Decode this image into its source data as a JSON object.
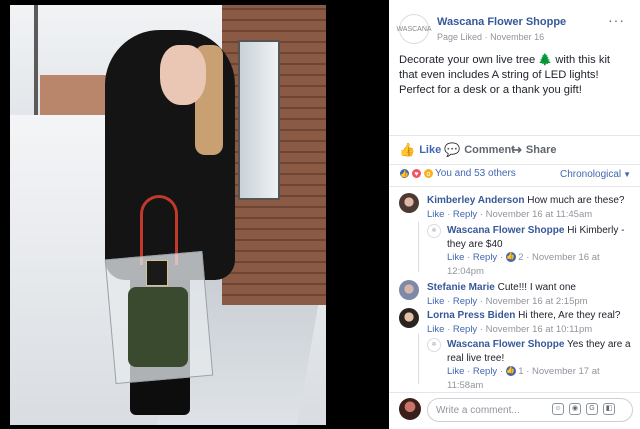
{
  "page": {
    "name": "Wascana Flower Shoppe",
    "status": "Page Liked",
    "date": "November 16",
    "avatar_text": "WASCANA"
  },
  "post": {
    "text": "Decorate your own live tree 🌲 with this kit that even includes A string of LED lights! Perfect for a desk or a thank you gift!"
  },
  "actions": {
    "like": "Like",
    "comment": "Comment",
    "share": "Share"
  },
  "reactions": {
    "summary": "You and 53 others"
  },
  "sort": {
    "label": "Chronological"
  },
  "comments": [
    {
      "author": "Kimberley Anderson",
      "text": "How much are these?",
      "like": "Like",
      "reply": "Reply",
      "time": "November 16 at 11:45am"
    },
    {
      "author": "Wascana Flower Shoppe",
      "text_line1": "Hi Kimberly -",
      "text_line2": "they are $40",
      "like": "Like",
      "reply": "Reply",
      "reactions": "2",
      "time_line1": "November 16 at",
      "time_line2": "12:04pm"
    },
    {
      "author": "Stefanie Marie",
      "text": "Cute!!! I want one",
      "like": "Like",
      "reply": "Reply",
      "time": "November 16 at 2:15pm"
    },
    {
      "author": "Lorna Press Biden",
      "text": "Hi there, Are they real?",
      "like": "Like",
      "reply": "Reply",
      "time": "November 16 at 10:11pm"
    },
    {
      "author": "Wascana Flower Shoppe",
      "text_line1": "Yes they are a",
      "text_line2": "real live tree!",
      "like": "Like",
      "reply": "Reply",
      "reactions": "1",
      "time": "November 17 at",
      "time_line2": "11:58am"
    }
  ],
  "composer": {
    "placeholder": "Write a comment..."
  },
  "colors": {
    "link": "#365899",
    "accent": "#4267b2",
    "muted": "#90949c"
  }
}
